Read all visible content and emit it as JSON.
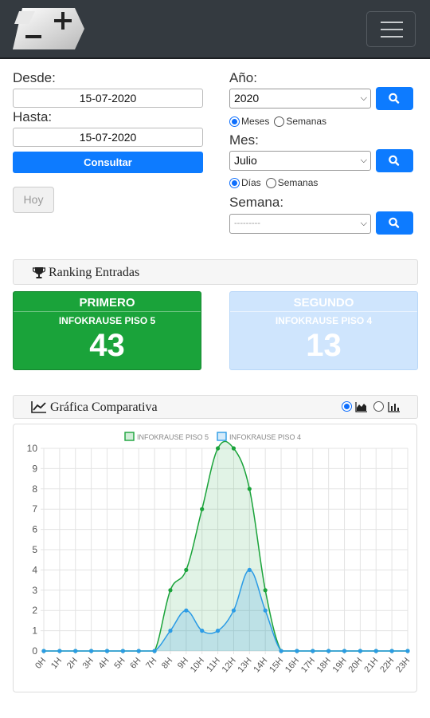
{
  "form": {
    "desde_label": "Desde:",
    "desde_value": "15-07-2020",
    "hasta_label": "Hasta:",
    "hasta_value": "15-07-2020",
    "consultar_label": "Consultar",
    "hoy_label": "Hoy",
    "anio_label": "Año:",
    "anio_value": "2020",
    "periodo_meses": "Meses",
    "periodo_semanas": "Semanas",
    "mes_label": "Mes:",
    "mes_value": "Julio",
    "dias_option": "Días",
    "semanas_option": "Semanas",
    "semana_label": "Semana:",
    "semana_value": "---------"
  },
  "ranking": {
    "title": "Ranking Entradas",
    "first": {
      "heading": "PRIMERO",
      "name": "INFOKRAUSE PISO 5",
      "count": "43",
      "color": "#1aa33a"
    },
    "second": {
      "heading": "SEGUNDO",
      "name": "INFOKRAUSE PISO 4",
      "count": "13",
      "color": "#cfe5fd"
    }
  },
  "comparativa": {
    "title": "Gráfica Comparativa",
    "selected_view": "area"
  },
  "chart_data": {
    "type": "area",
    "categories": [
      "0H",
      "1H",
      "2H",
      "3H",
      "4H",
      "5H",
      "6H",
      "7H",
      "8H",
      "9H",
      "10H",
      "11H",
      "12H",
      "13H",
      "14H",
      "15H",
      "16H",
      "17H",
      "18H",
      "19H",
      "20H",
      "21H",
      "22H",
      "23H"
    ],
    "series": [
      {
        "name": "INFOKRAUSE PISO 5",
        "color": "#1aa33a",
        "values": [
          0,
          0,
          0,
          0,
          0,
          0,
          0,
          0,
          3,
          4,
          7,
          10,
          10,
          8,
          3,
          0,
          0,
          0,
          0,
          0,
          0,
          0,
          0,
          0
        ]
      },
      {
        "name": "INFOKRAUSE PISO 4",
        "color": "#2b9be5",
        "values": [
          0,
          0,
          0,
          0,
          0,
          0,
          0,
          0,
          1,
          2,
          1,
          1,
          2,
          4,
          2,
          0,
          0,
          0,
          0,
          0,
          0,
          0,
          0,
          0
        ]
      }
    ],
    "y_ticks": [
      "0",
      "1",
      "2",
      "3",
      "4",
      "5",
      "6",
      "7",
      "8",
      "9",
      "10"
    ],
    "ylim": [
      0,
      10
    ],
    "grid": true,
    "legend": "top-center"
  }
}
